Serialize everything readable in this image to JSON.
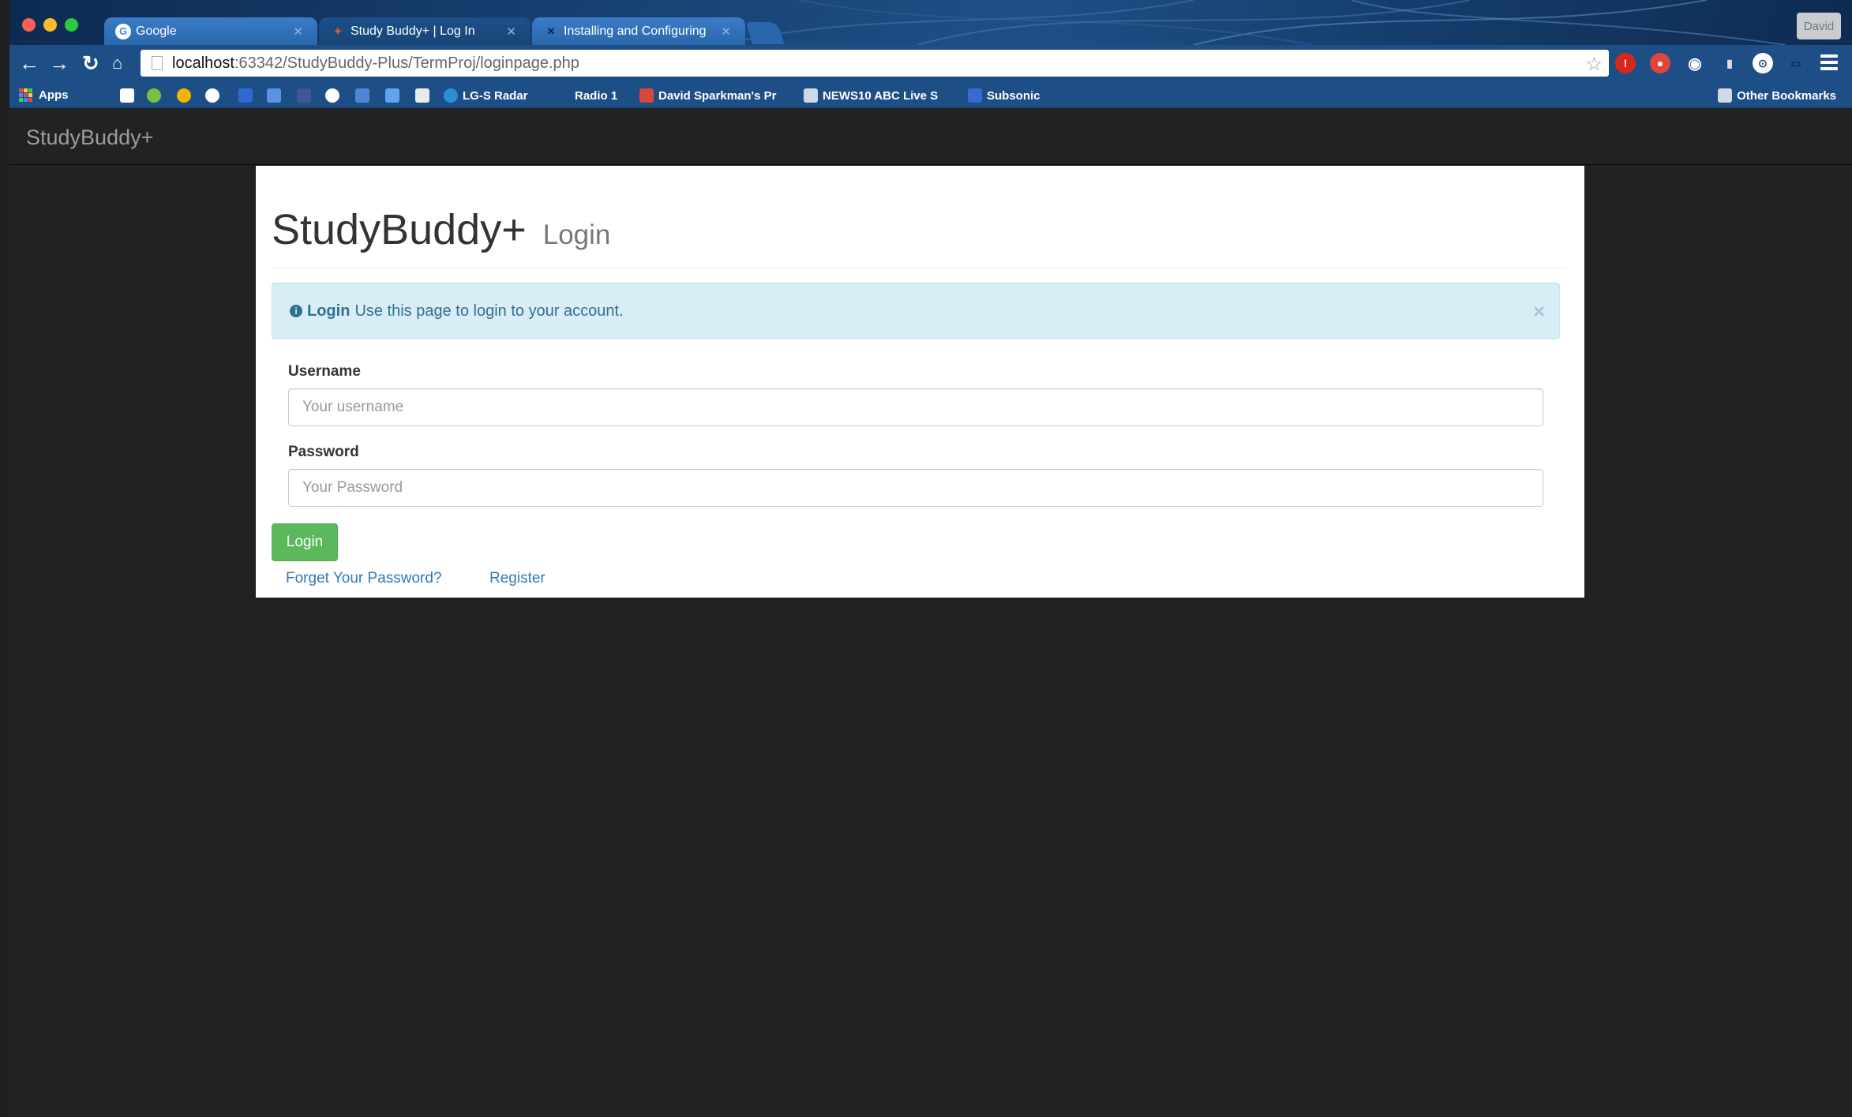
{
  "browser": {
    "tabs": [
      {
        "title": "Google"
      },
      {
        "title": "Study Buddy+ | Log In"
      },
      {
        "title": "Installing and Configuring"
      }
    ],
    "profile_name": "David",
    "url_host": "localhost",
    "url_path": ":63342/StudyBuddy-Plus/TermProj/loginpage.php",
    "bookmarks": [
      {
        "label": "Apps"
      },
      {
        "label": "LG-S Radar"
      },
      {
        "label": "Radio 1"
      },
      {
        "label": "David Sparkman's Pr"
      },
      {
        "label": "NEWS10 ABC Live S"
      },
      {
        "label": "Subsonic"
      }
    ],
    "other_bookmarks": "Other Bookmarks"
  },
  "app": {
    "brand": "StudyBuddy+",
    "page_title": "StudyBuddy+",
    "page_subtitle": "Login",
    "alert": {
      "title": "Login",
      "message": "Use this page to login to your account.",
      "close": "×"
    },
    "form": {
      "username_label": "Username",
      "username_placeholder": "Your username",
      "password_label": "Password",
      "password_placeholder": "Your Password",
      "submit_label": "Login"
    },
    "links": {
      "forgot": "Forget Your Password?",
      "register": "Register"
    }
  }
}
